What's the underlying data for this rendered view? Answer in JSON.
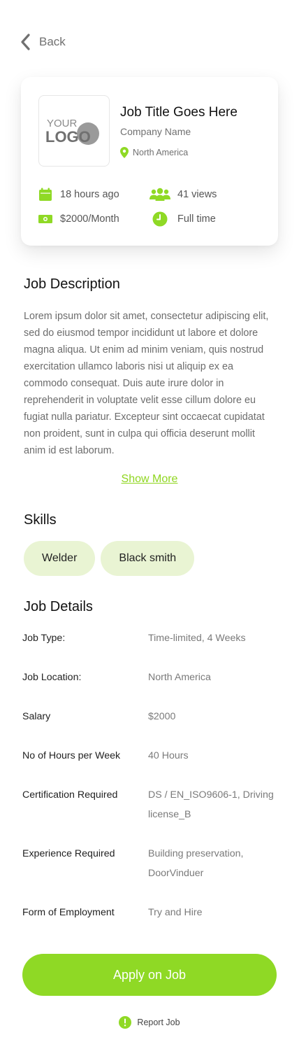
{
  "nav": {
    "back_label": "Back"
  },
  "job": {
    "logo_line1": "YOUR",
    "logo_line2": "LOGO",
    "title": "Job Title Goes Here",
    "company": "Company Name",
    "location": "North America",
    "posted": "18 hours ago",
    "views": "41 views",
    "salary": "$2000/Month",
    "type": "Full time"
  },
  "description": {
    "heading": "Job Description",
    "text": "Lorem ipsum dolor sit amet, consectetur adipiscing elit, sed do eiusmod tempor incididunt ut labore et dolore magna aliqua. Ut enim ad minim veniam, quis nostrud exercitation ullamco laboris nisi ut aliquip ex ea commodo consequat. Duis aute irure dolor in reprehenderit in voluptate velit esse cillum dolore eu fugiat nulla pariatur. Excepteur sint occaecat cupidatat non proident, sunt in culpa qui officia deserunt mollit anim id est laborum.",
    "show_more": "Show More"
  },
  "skills": {
    "heading": "Skills",
    "items": [
      "Welder",
      "Black smith"
    ]
  },
  "details": {
    "heading": "Job Details",
    "rows": [
      {
        "label": "Job Type:",
        "value": "Time-limited, 4 Weeks"
      },
      {
        "label": "Job Location:",
        "value": "North America"
      },
      {
        "label": "Salary",
        "value": "$2000"
      },
      {
        "label": "No of Hours per Week",
        "value": "40 Hours"
      },
      {
        "label": "Certification Required",
        "value": "DS / EN_ISO9606-1, Driving license_B"
      },
      {
        "label": "Experience Required",
        "value": "Building preservation, DoorVinduer"
      },
      {
        "label": "Form of Employment",
        "value": "Try and Hire"
      }
    ]
  },
  "actions": {
    "apply_label": "Apply on Job",
    "report_label": "Report Job"
  },
  "colors": {
    "accent": "#8FD925",
    "chip_bg": "#E9F4D3"
  },
  "icons": [
    "chevron-left-icon",
    "map-pin-icon",
    "calendar-icon",
    "users-icon",
    "money-icon",
    "clock-icon",
    "alert-icon"
  ]
}
